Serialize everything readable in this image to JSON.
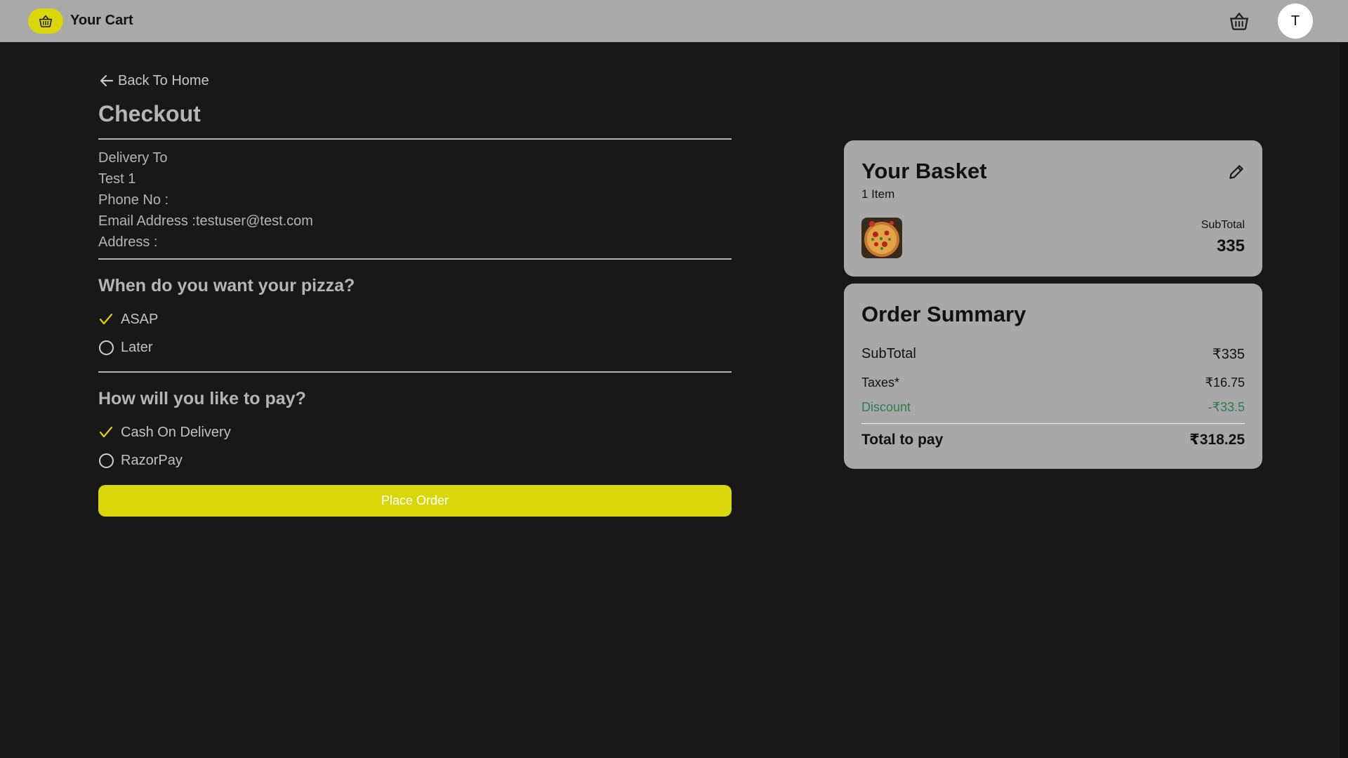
{
  "header": {
    "title": "Your Cart",
    "avatar_initial": "T"
  },
  "nav": {
    "back_label": "Back To Home"
  },
  "checkout": {
    "title": "Checkout",
    "delivery": {
      "heading": "Delivery To",
      "name": "Test 1",
      "phone": "Phone No :",
      "email": "Email Address :testuser@test.com",
      "address": "Address :"
    },
    "timing": {
      "heading": "When do you want your pizza?",
      "options": [
        {
          "label": "ASAP",
          "selected": true
        },
        {
          "label": "Later",
          "selected": false
        }
      ]
    },
    "payment": {
      "heading": "How will you like to pay?",
      "options": [
        {
          "label": "Cash On Delivery",
          "selected": true
        },
        {
          "label": "RazorPay",
          "selected": false
        }
      ]
    },
    "place_order_label": "Place Order"
  },
  "basket": {
    "title": "Your Basket",
    "count": "1 Item",
    "subtotal_label": "SubTotal",
    "subtotal_value": "335"
  },
  "summary": {
    "title": "Order Summary",
    "rows": [
      {
        "label": "SubTotal",
        "value": "₹335"
      },
      {
        "label": "Taxes*",
        "value": "₹16.75"
      },
      {
        "label": "Discount",
        "value": "-₹33.5"
      }
    ],
    "total_label": "Total to pay",
    "total_value": "₹318.25"
  },
  "colors": {
    "accent": "#d9d60a",
    "background": "#181818",
    "topbar": "#a9a9a9",
    "card": "#a8a8a8",
    "discount": "#2e7d4f"
  },
  "icons": {
    "brand": "basket-icon",
    "back": "arrow-left-icon",
    "edit": "pencil-icon",
    "selected": "check-icon",
    "unselected": "radio-empty-icon"
  }
}
